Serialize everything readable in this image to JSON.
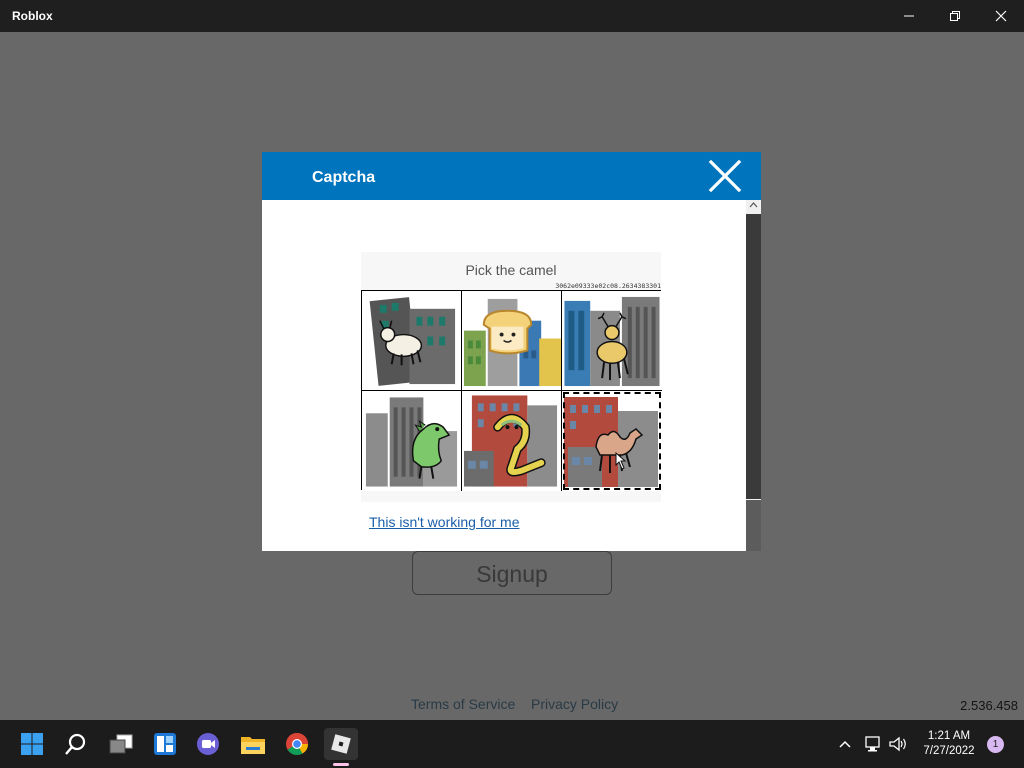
{
  "window": {
    "title": "Roblox",
    "controls": [
      "minimize-icon",
      "restore-icon",
      "close-icon"
    ]
  },
  "page": {
    "signup_label": "Signup",
    "footer_links": [
      "Terms of Service",
      "Privacy Policy"
    ],
    "version": "2.536.458"
  },
  "captcha": {
    "title": "Captcha",
    "prompt": "Pick the camel",
    "session_id": "3062e09333e02c08.2634383301",
    "tiles": [
      {
        "subject": "goat",
        "selected": false
      },
      {
        "subject": "bread",
        "selected": false
      },
      {
        "subject": "deer",
        "selected": false
      },
      {
        "subject": "dinosaur",
        "selected": false
      },
      {
        "subject": "cobra",
        "selected": false
      },
      {
        "subject": "camel",
        "selected": true
      }
    ],
    "help_link": "This isn't working for me"
  },
  "taskbar": {
    "apps": [
      "start-icon",
      "search-icon",
      "task-view-icon",
      "widgets-icon",
      "teams-chat-icon",
      "file-explorer-icon",
      "chrome-icon",
      "roblox-icon"
    ],
    "active_app": "roblox-icon",
    "time": "1:21 AM",
    "date": "7/27/2022",
    "notification_count": "1"
  },
  "colors": {
    "modal_header": "#0074bd",
    "page_background": "#686868",
    "taskbar": "#1c1c1c",
    "link": "#1a5ea8"
  }
}
